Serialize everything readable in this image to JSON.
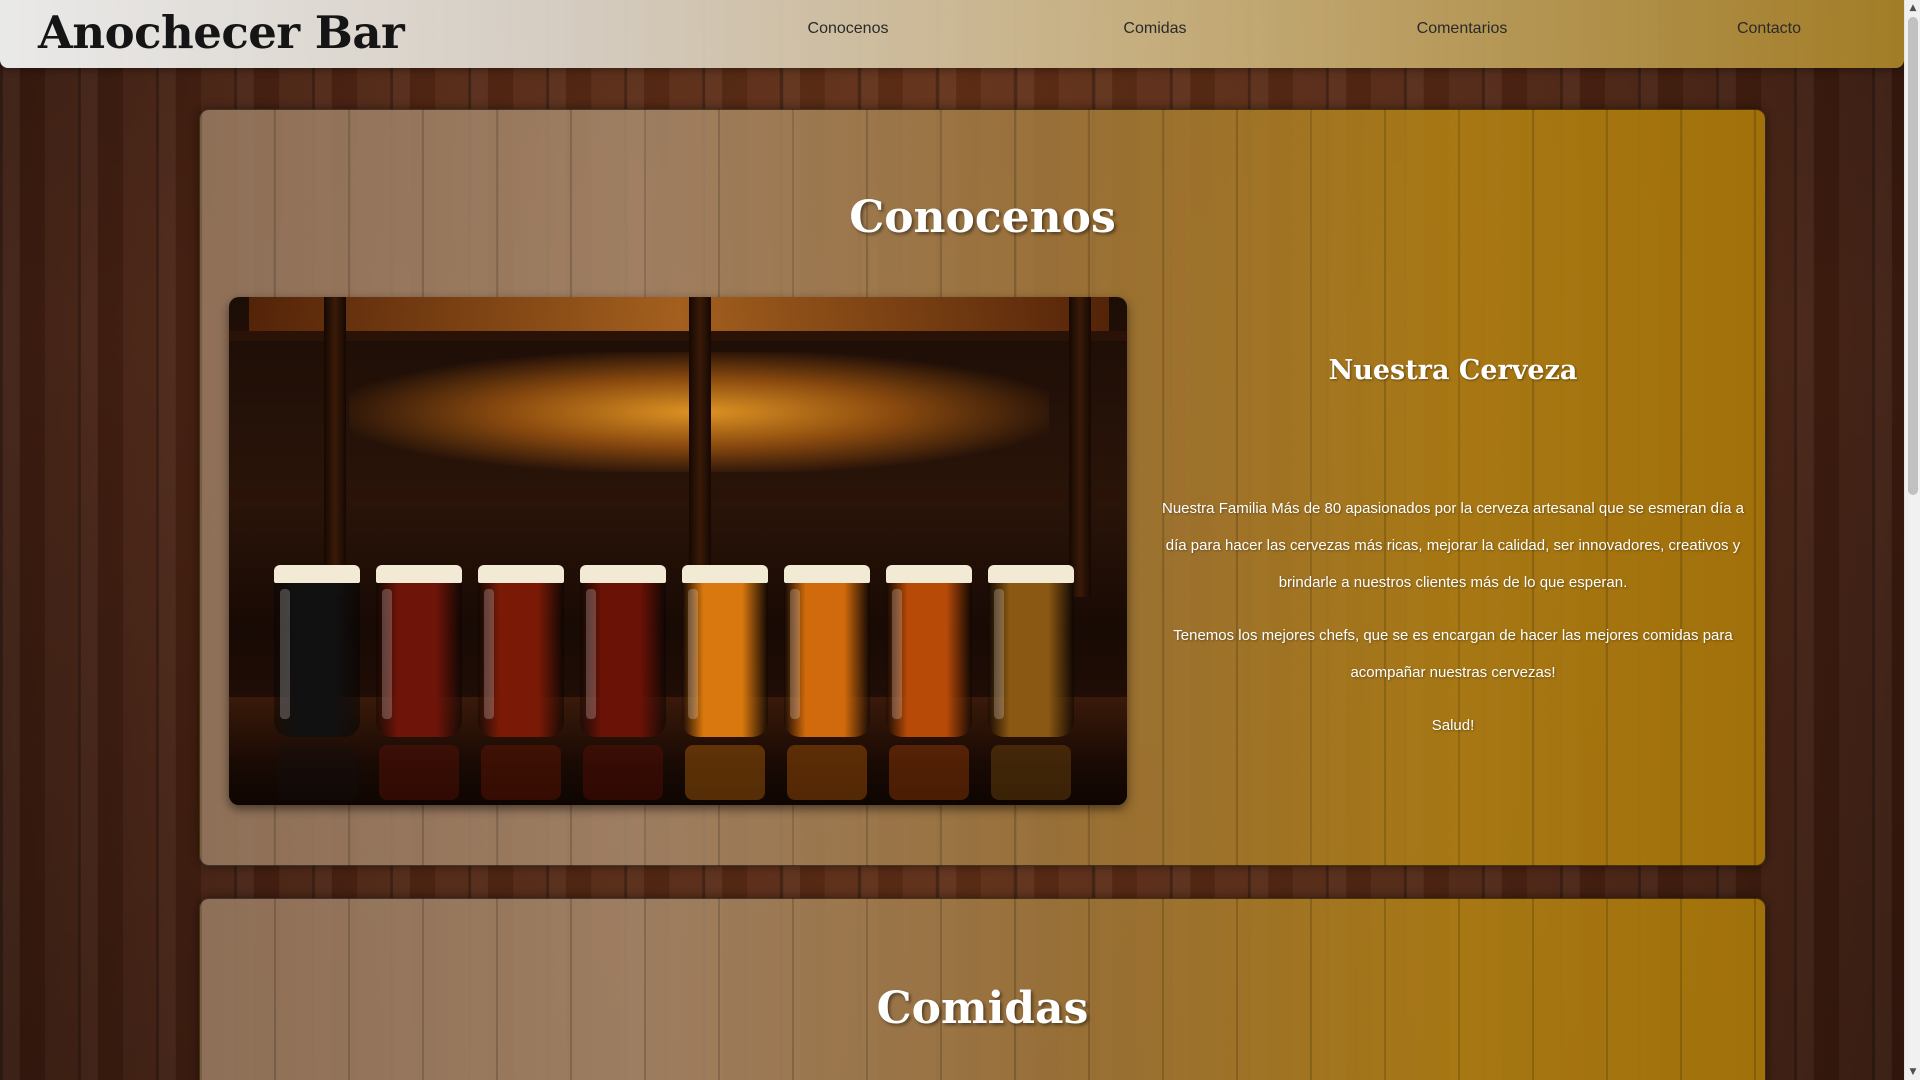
{
  "nav": {
    "brand": "Anochecer Bar",
    "links": [
      "Conocenos",
      "Comidas",
      "Comentarios",
      "Contacto"
    ]
  },
  "about": {
    "title": "Conocenos",
    "heading": "Nuestra Cerveza",
    "paragraphs": [
      "Nuestra Familia Más de 80 apasionados por la cerveza artesanal que se esmeran día a día para hacer las cervezas más ricas, mejorar la calidad, ser innovadores, creativos y brindarle a nuestros clientes más de lo que esperan.",
      "Tenemos los mejores chefs, que se es encargan de hacer las mejores comidas para acompañar nuestras cervezas!",
      "Salud!"
    ],
    "photo": {
      "subject": "beer-glasses-on-bar-counter",
      "beer_colors": [
        "#111111",
        "#6e1408",
        "#7a1a06",
        "#6a1206",
        "#d8780e",
        "#d06a0c",
        "#b84a08",
        "#8a5812"
      ]
    }
  },
  "food": {
    "title": "Comidas"
  },
  "theme": {
    "accent_gold": "#b0800f",
    "text_light": "#ffffff",
    "brand_text": "#151515"
  }
}
